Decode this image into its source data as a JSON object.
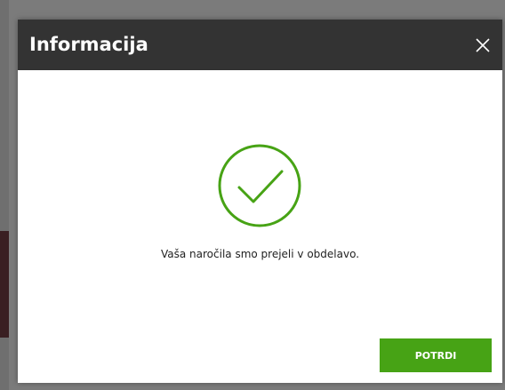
{
  "dialog": {
    "title": "Informacija",
    "close_icon": "close-icon",
    "status_icon": "check-circle-icon",
    "message": "Vaša naročila smo prejeli v obdelavo.",
    "confirm_label": "POTRDI"
  },
  "colors": {
    "header_bg": "#333333",
    "accent_green": "#47a315",
    "overlay": "#7b7b7b"
  }
}
